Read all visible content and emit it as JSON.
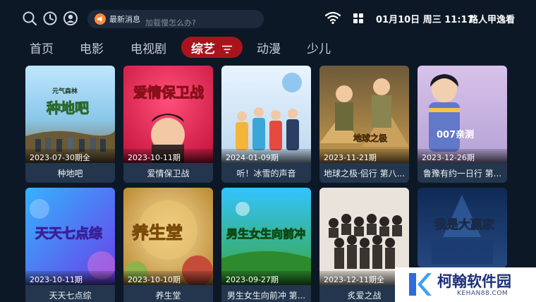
{
  "topbar": {
    "search_icon": "search-icon",
    "history_icon": "history-icon",
    "account_icon": "user-icon",
    "news_label": "最新消息",
    "news_ticker": "加载慢怎么办?",
    "wifi_icon": "wifi-icon",
    "apps_icon": "apps-grid-icon",
    "clock": "01月10日 周三 11:17",
    "user_name": "路人甲逸看"
  },
  "tabs": {
    "items": [
      {
        "label": "首页"
      },
      {
        "label": "电影"
      },
      {
        "label": "电视剧"
      },
      {
        "label": "综艺"
      },
      {
        "label": "动漫"
      },
      {
        "label": "少儿"
      }
    ],
    "active_index": 3,
    "filter_icon": "filter-icon",
    "active_color": "#a9141c"
  },
  "cards": [
    {
      "episode": "2023-07-30期全",
      "title": "种地吧",
      "poster_text": "种地吧",
      "brand": "元气森林"
    },
    {
      "episode": "2023-10-11期",
      "title": "爱情保卫战",
      "poster_text": "爱情保卫战"
    },
    {
      "episode": "2024-01-09期",
      "title": "听！冰雪的声音"
    },
    {
      "episode": "2023-11-21期",
      "title": "地球之极·侣行 第八...",
      "poster_text": "地球之极"
    },
    {
      "episode": "2023-12-26期",
      "title": "鲁豫有约一日行 第...",
      "poster_text": "007亲测"
    },
    {
      "episode": "2023-10-11期",
      "title": "天天七点综",
      "poster_text": "天天七点综"
    },
    {
      "episode": "2023-10-10期",
      "title": "养生堂",
      "poster_text": "养生堂"
    },
    {
      "episode": "2023-09-27期",
      "title": "男生女生向前冲 第...",
      "poster_text": "男生女生向前冲"
    },
    {
      "episode": "2023-12-11期全",
      "title": "炙爱之战"
    },
    {
      "poster_text": "我是大赢家"
    }
  ],
  "watermark": {
    "name": "柯翰软件园",
    "url": "KEHAN88.COM"
  }
}
